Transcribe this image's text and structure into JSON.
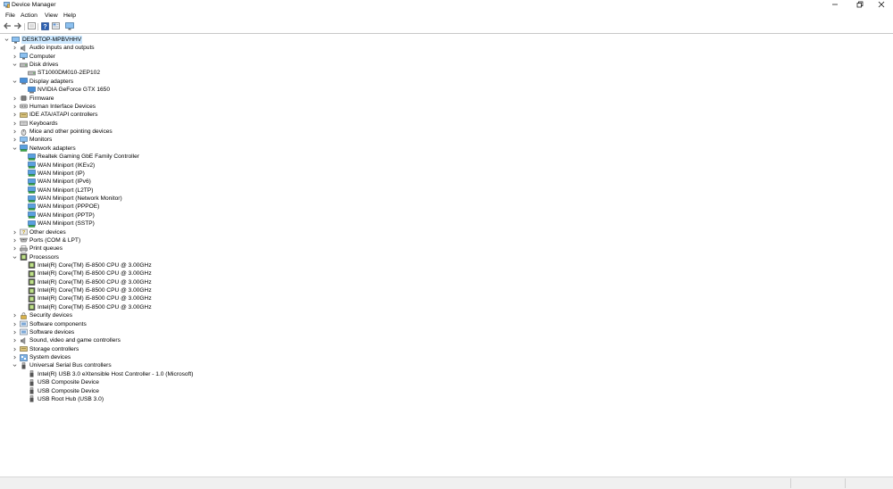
{
  "window": {
    "title": "Device Manager",
    "minimize_icon": "minimize-icon",
    "restore_icon": "restore-icon",
    "close_icon": "close-icon"
  },
  "menu": [
    "File",
    "Action",
    "View",
    "Help"
  ],
  "toolbar": [
    "back-arrow-icon",
    "forward-arrow-icon",
    "properties-icon",
    "help-icon",
    "show-hidden-icon",
    "monitor-icon"
  ],
  "colors": {
    "selection": "#cce8ff",
    "accent": "#1a73c8",
    "chevron": "#555555"
  },
  "tree": [
    {
      "label": "DESKTOP-MPBVHHV",
      "level": 0,
      "toggle": "expanded",
      "icon": "computer-icon",
      "root": true
    },
    {
      "label": "Audio inputs and outputs",
      "level": 1,
      "toggle": "collapsed",
      "icon": "speaker-icon"
    },
    {
      "label": "Computer",
      "level": 1,
      "toggle": "collapsed",
      "icon": "computer-icon"
    },
    {
      "label": "Disk drives",
      "level": 1,
      "toggle": "expanded",
      "icon": "disk-icon"
    },
    {
      "label": "ST1000DM010-2EP102",
      "level": 2,
      "toggle": "none",
      "icon": "disk-icon"
    },
    {
      "label": "Display adapters",
      "level": 1,
      "toggle": "expanded",
      "icon": "display-icon"
    },
    {
      "label": "NVIDIA GeForce GTX 1650",
      "level": 2,
      "toggle": "none",
      "icon": "display-icon"
    },
    {
      "label": "Firmware",
      "level": 1,
      "toggle": "collapsed",
      "icon": "chip-icon"
    },
    {
      "label": "Human Interface Devices",
      "level": 1,
      "toggle": "collapsed",
      "icon": "hid-icon"
    },
    {
      "label": "IDE ATA/ATAPI controllers",
      "level": 1,
      "toggle": "collapsed",
      "icon": "controller-icon"
    },
    {
      "label": "Keyboards",
      "level": 1,
      "toggle": "collapsed",
      "icon": "keyboard-icon"
    },
    {
      "label": "Mice and other pointing devices",
      "level": 1,
      "toggle": "collapsed",
      "icon": "mouse-icon"
    },
    {
      "label": "Monitors",
      "level": 1,
      "toggle": "collapsed",
      "icon": "monitor-icon"
    },
    {
      "label": "Network adapters",
      "level": 1,
      "toggle": "expanded",
      "icon": "network-icon"
    },
    {
      "label": "Realtek Gaming GbE Family Controller",
      "level": 2,
      "toggle": "none",
      "icon": "network-icon"
    },
    {
      "label": "WAN Miniport (IKEv2)",
      "level": 2,
      "toggle": "none",
      "icon": "network-icon"
    },
    {
      "label": "WAN Miniport (IP)",
      "level": 2,
      "toggle": "none",
      "icon": "network-icon"
    },
    {
      "label": "WAN Miniport (IPv6)",
      "level": 2,
      "toggle": "none",
      "icon": "network-icon"
    },
    {
      "label": "WAN Miniport (L2TP)",
      "level": 2,
      "toggle": "none",
      "icon": "network-icon"
    },
    {
      "label": "WAN Miniport (Network Monitor)",
      "level": 2,
      "toggle": "none",
      "icon": "network-icon"
    },
    {
      "label": "WAN Miniport (PPPOE)",
      "level": 2,
      "toggle": "none",
      "icon": "network-icon"
    },
    {
      "label": "WAN Miniport (PPTP)",
      "level": 2,
      "toggle": "none",
      "icon": "network-icon"
    },
    {
      "label": "WAN Miniport (SSTP)",
      "level": 2,
      "toggle": "none",
      "icon": "network-icon"
    },
    {
      "label": "Other devices",
      "level": 1,
      "toggle": "collapsed",
      "icon": "unknown-device-icon"
    },
    {
      "label": "Ports (COM & LPT)",
      "level": 1,
      "toggle": "collapsed",
      "icon": "port-icon"
    },
    {
      "label": "Print queues",
      "level": 1,
      "toggle": "collapsed",
      "icon": "printer-icon"
    },
    {
      "label": "Processors",
      "level": 1,
      "toggle": "expanded",
      "icon": "processor-icon"
    },
    {
      "label": "Intel(R) Core(TM) i5-8500 CPU @ 3.00GHz",
      "level": 2,
      "toggle": "none",
      "icon": "processor-icon"
    },
    {
      "label": "Intel(R) Core(TM) i5-8500 CPU @ 3.00GHz",
      "level": 2,
      "toggle": "none",
      "icon": "processor-icon"
    },
    {
      "label": "Intel(R) Core(TM) i5-8500 CPU @ 3.00GHz",
      "level": 2,
      "toggle": "none",
      "icon": "processor-icon"
    },
    {
      "label": "Intel(R) Core(TM) i5-8500 CPU @ 3.00GHz",
      "level": 2,
      "toggle": "none",
      "icon": "processor-icon"
    },
    {
      "label": "Intel(R) Core(TM) i5-8500 CPU @ 3.00GHz",
      "level": 2,
      "toggle": "none",
      "icon": "processor-icon"
    },
    {
      "label": "Intel(R) Core(TM) i5-8500 CPU @ 3.00GHz",
      "level": 2,
      "toggle": "none",
      "icon": "processor-icon"
    },
    {
      "label": "Security devices",
      "level": 1,
      "toggle": "collapsed",
      "icon": "security-icon"
    },
    {
      "label": "Software components",
      "level": 1,
      "toggle": "collapsed",
      "icon": "component-icon"
    },
    {
      "label": "Software devices",
      "level": 1,
      "toggle": "collapsed",
      "icon": "component-icon"
    },
    {
      "label": "Sound, video and game controllers",
      "level": 1,
      "toggle": "collapsed",
      "icon": "speaker-icon"
    },
    {
      "label": "Storage controllers",
      "level": 1,
      "toggle": "collapsed",
      "icon": "controller-icon"
    },
    {
      "label": "System devices",
      "level": 1,
      "toggle": "collapsed",
      "icon": "system-icon"
    },
    {
      "label": "Universal Serial Bus controllers",
      "level": 1,
      "toggle": "expanded",
      "icon": "usb-icon"
    },
    {
      "label": "Intel(R) USB 3.0 eXtensible Host Controller - 1.0 (Microsoft)",
      "level": 2,
      "toggle": "none",
      "icon": "usb-icon"
    },
    {
      "label": "USB Composite Device",
      "level": 2,
      "toggle": "none",
      "icon": "usb-icon"
    },
    {
      "label": "USB Composite Device",
      "level": 2,
      "toggle": "none",
      "icon": "usb-icon"
    },
    {
      "label": "USB Root Hub (USB 3.0)",
      "level": 2,
      "toggle": "none",
      "icon": "usb-icon"
    }
  ]
}
